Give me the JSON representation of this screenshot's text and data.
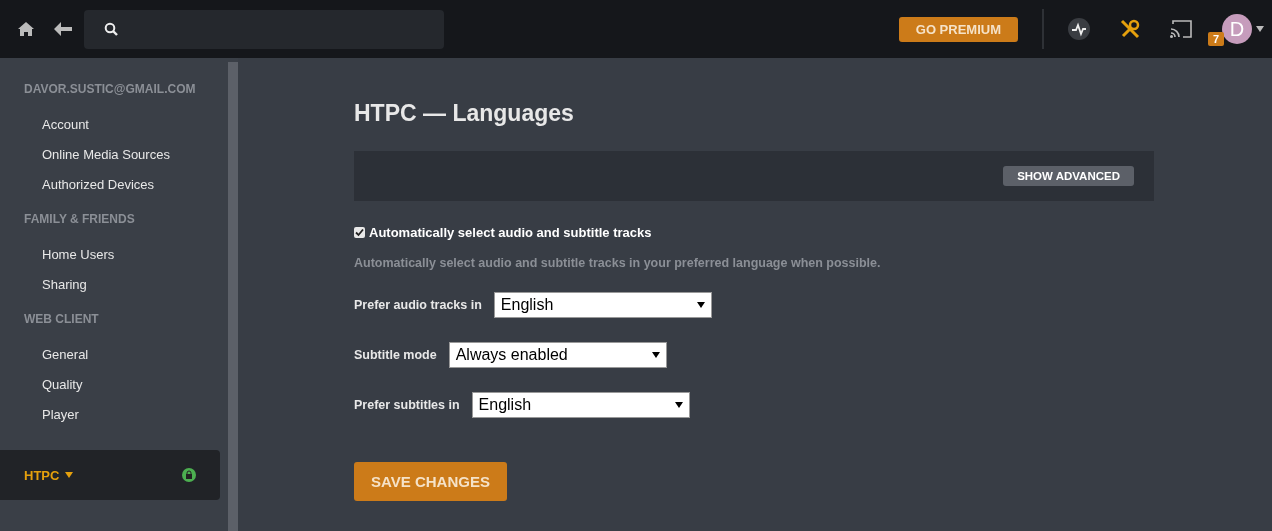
{
  "topbar": {
    "premium_button": "GO PREMIUM",
    "notification_count": "7",
    "avatar_letter": "D"
  },
  "sidebar": {
    "sections": [
      {
        "heading": "DAVOR.SUSTIC@GMAIL.COM",
        "items": [
          {
            "label": "Account",
            "selected": false
          },
          {
            "label": "Online Media Sources",
            "selected": false
          },
          {
            "label": "Authorized Devices",
            "selected": false
          }
        ]
      },
      {
        "heading": "FAMILY & FRIENDS",
        "items": [
          {
            "label": "Home Users",
            "selected": false
          },
          {
            "label": "Sharing",
            "selected": false
          }
        ]
      },
      {
        "heading": "WEB CLIENT",
        "items": [
          {
            "label": "General",
            "selected": false
          },
          {
            "label": "Quality",
            "selected": false
          },
          {
            "label": "Player",
            "selected": false
          }
        ]
      }
    ],
    "server": {
      "label": "HTPC",
      "selected": true,
      "locked": true
    }
  },
  "main": {
    "title": "HTPC — Languages",
    "advanced_button": "SHOW ADVANCED",
    "checkbox": {
      "label": "Automatically select audio and subtitle tracks",
      "checked": true
    },
    "hint": "Automatically select audio and subtitle tracks in your preferred language when possible.",
    "fields": [
      {
        "label": "Prefer audio tracks in",
        "value": "English"
      },
      {
        "label": "Subtitle mode",
        "value": "Always enabled"
      },
      {
        "label": "Prefer subtitles in",
        "value": "English"
      }
    ],
    "save_button": "SAVE CHANGES"
  }
}
